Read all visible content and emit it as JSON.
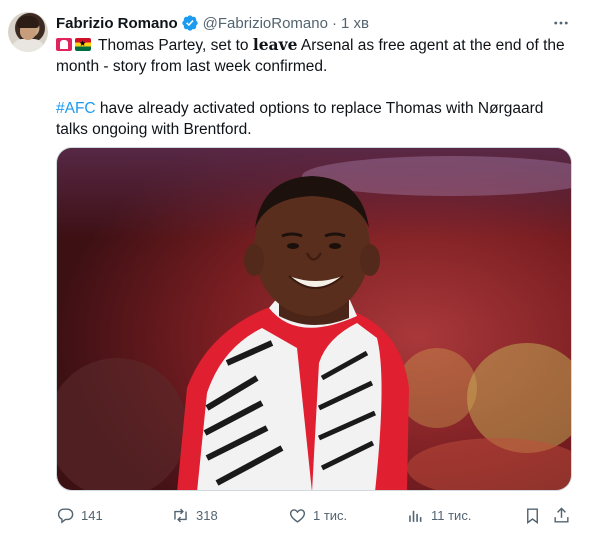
{
  "author": {
    "name": "Fabrizio Romano",
    "handle": "@FabrizioRomano",
    "separator": "·",
    "time": "1 хв"
  },
  "tweet": {
    "line1_pre": "Thomas Partey, set to ",
    "line1_bold": "leave",
    "line1_post": " Arsenal as free agent at the end of the month - story from last week confirmed.",
    "hashtag": "#AFC",
    "line2": " have already activated options to replace Thomas with Nørgaard talks ongoing with Brentford."
  },
  "actions": {
    "replies": "141",
    "retweets": "318",
    "likes": "1 тис.",
    "views": "11 тис."
  },
  "colors": {
    "accent": "#1d9bf0",
    "muted": "#536471",
    "text": "#0f1419"
  },
  "icons": [
    "verified-badge-icon",
    "more-icon",
    "breaking-news-icon",
    "ghana-flag-icon",
    "reply-icon",
    "retweet-icon",
    "like-icon",
    "views-icon",
    "bookmark-icon",
    "share-icon"
  ]
}
